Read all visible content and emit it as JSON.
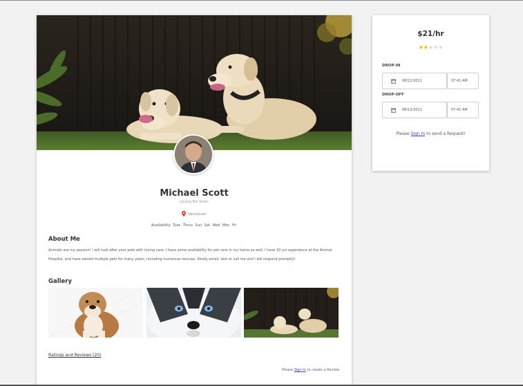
{
  "profile": {
    "name": "Michael Scott",
    "subtitle": "Loving Pet Sitter",
    "location": "Vancouver",
    "availability_label": "Availability:",
    "days": [
      "Tues",
      "Thrus",
      "Sun",
      "Sat",
      "Wed",
      "Mon",
      "Fri"
    ],
    "about_title": "About Me",
    "about_text": "Animals are my passion! I will look after your pets with loving care. I have some availability for pet care in my home as well. I have 10 yrs experience at the Animal Hospital, and have owned multiple pets for many years, including numerous rescues. Kindly email, text or call me and I will respond promptly!",
    "gallery_title": "Gallery",
    "reviews_link": "Ratings and Reviews (20)",
    "review_prompt_prefix": "Please",
    "review_prompt_link": "Sign In",
    "review_prompt_suffix": "to create a Review"
  },
  "booking": {
    "price": "$21/hr",
    "rating": 2,
    "rating_max": 5,
    "dropin_label": "DROP-IN",
    "dropin_date": "08/11/2021",
    "dropin_time": "07:41 AM",
    "dropoff_label": "DROP-OFF",
    "dropoff_date": "08/12/2021",
    "dropoff_time": "07:41 AM",
    "signin_prefix": "Please",
    "signin_link": "Sign In",
    "signin_suffix": "to send a Request!"
  },
  "colors": {
    "accent_link": "#4a3aa8",
    "star_on": "#f4b400",
    "star_off": "#d5d5d5",
    "pin": "#e53935"
  },
  "icons": [
    "location-pin-icon",
    "calendar-icon",
    "star-icon"
  ]
}
